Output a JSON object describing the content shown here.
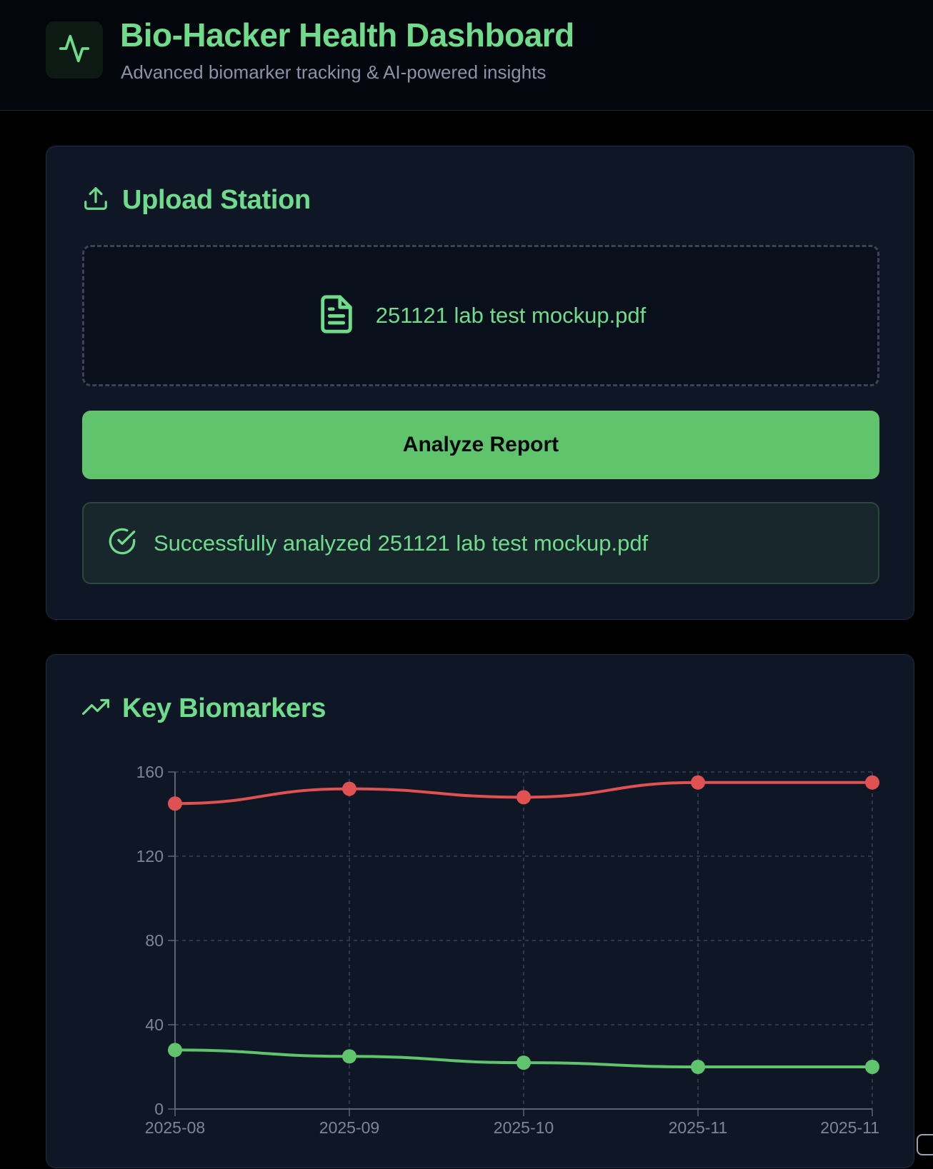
{
  "header": {
    "logo_icon": "activity-pulse-icon",
    "title": "Bio-Hacker Health Dashboard",
    "subtitle": "Advanced biomarker tracking & AI-powered insights"
  },
  "upload": {
    "icon": "upload-icon",
    "title": "Upload Station",
    "file_icon": "file-text-icon",
    "file_name": "251121 lab test mockup.pdf",
    "analyze_label": "Analyze Report",
    "success_icon": "check-circle-icon",
    "success_message": "Successfully analyzed 251121 lab test mockup.pdf"
  },
  "biomarkers": {
    "icon": "trending-up-icon",
    "title": "Key Biomarkers"
  },
  "colors": {
    "accent": "#6fdc8c",
    "button": "#5fc46b",
    "series_red": "#e05252",
    "series_green": "#5fc46b"
  },
  "chart_data": {
    "type": "line",
    "x": [
      "2025-08",
      "2025-09",
      "2025-10",
      "2025-11",
      "2025-11"
    ],
    "series": [
      {
        "color": "#e05252",
        "values": [
          145,
          152,
          148,
          155,
          155
        ]
      },
      {
        "color": "#5fc46b",
        "values": [
          28,
          25,
          22,
          20,
          20
        ]
      }
    ],
    "ylim": [
      0,
      160
    ],
    "yticks": [
      0,
      40,
      80,
      120,
      160
    ],
    "grid": true,
    "title": "",
    "xlabel": "",
    "ylabel": ""
  }
}
